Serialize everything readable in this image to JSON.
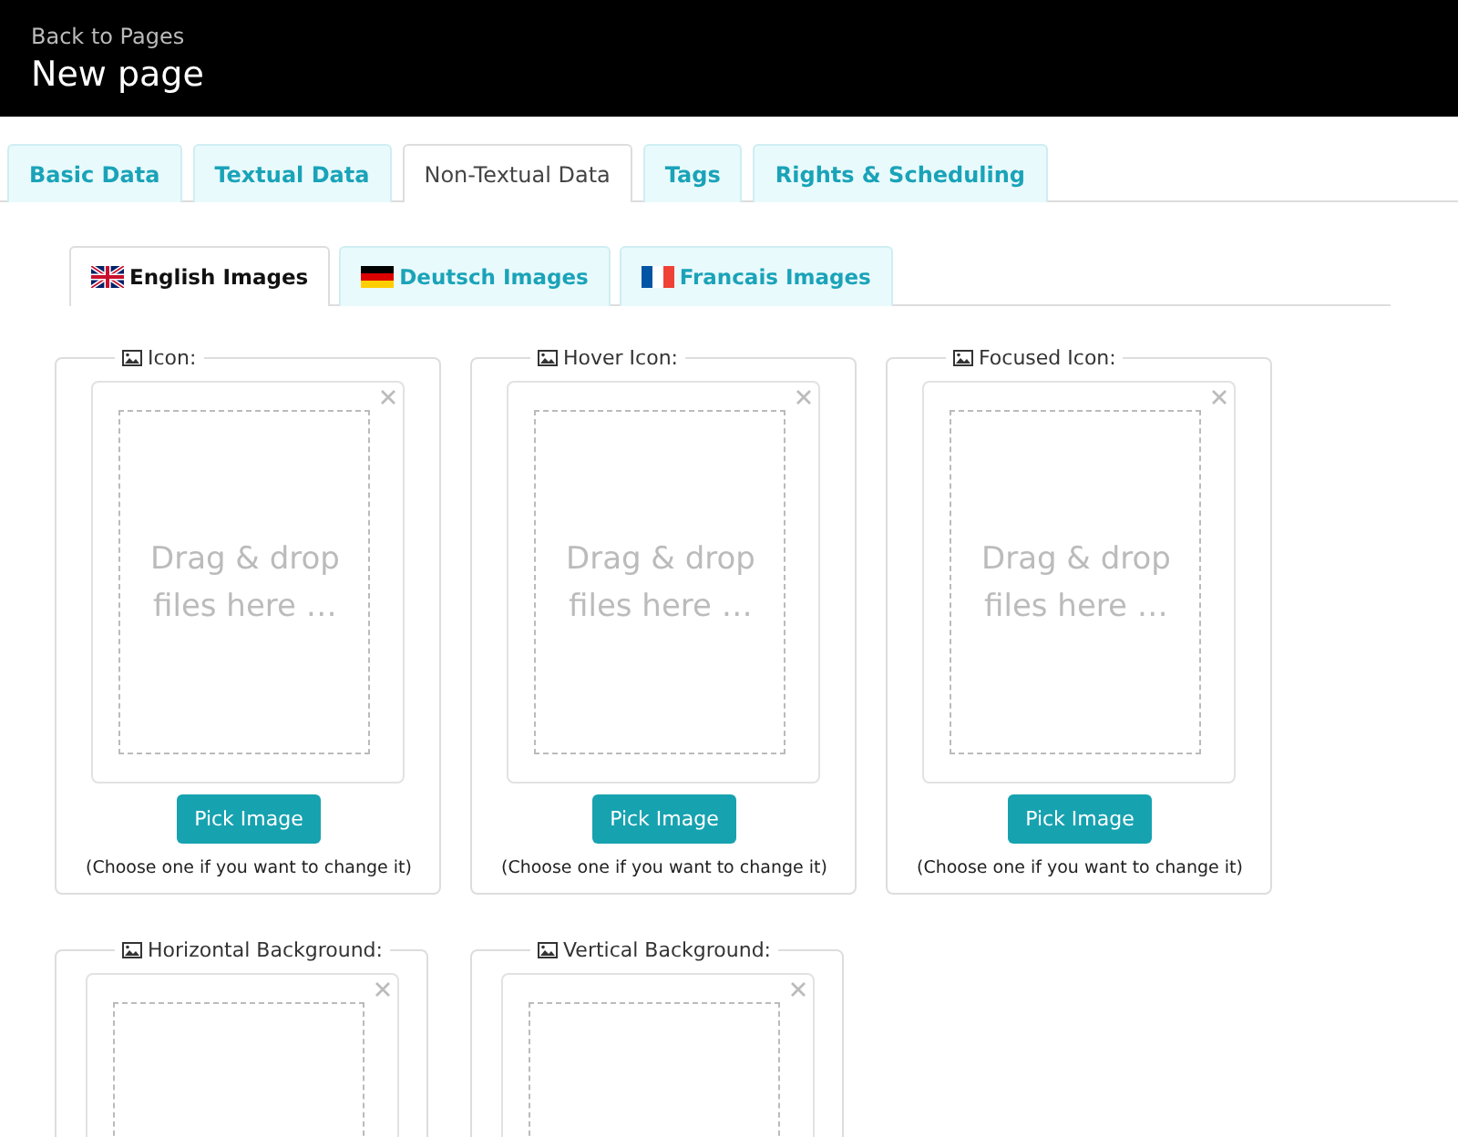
{
  "header": {
    "back_link": "Back to Pages",
    "title": "New page"
  },
  "tabs": [
    {
      "label": "Basic Data",
      "selected": false
    },
    {
      "label": "Textual Data",
      "selected": false
    },
    {
      "label": "Non-Textual Data",
      "selected": true
    },
    {
      "label": "Tags",
      "selected": false
    },
    {
      "label": "Rights & Scheduling",
      "selected": false
    }
  ],
  "language_tabs": [
    {
      "label": "English Images",
      "kind": "uk",
      "selected": true
    },
    {
      "label": "Deutsch Images",
      "kind": "de",
      "selected": false
    },
    {
      "label": "Francais Images",
      "kind": "fr",
      "selected": false
    }
  ],
  "image_slots": [
    {
      "label": "Icon:",
      "drop_text": "Drag & drop files here …",
      "button": "Pick Image",
      "hint": "(Choose one if you want to change it)"
    },
    {
      "label": "Hover Icon:",
      "drop_text": "Drag & drop files here …",
      "button": "Pick Image",
      "hint": "(Choose one if you want to change it)"
    },
    {
      "label": "Focused Icon:",
      "drop_text": "Drag & drop files here …",
      "button": "Pick Image",
      "hint": "(Choose one if you want to change it)"
    },
    {
      "label": "Horizontal Background:"
    },
    {
      "label": "Vertical Background:"
    }
  ]
}
